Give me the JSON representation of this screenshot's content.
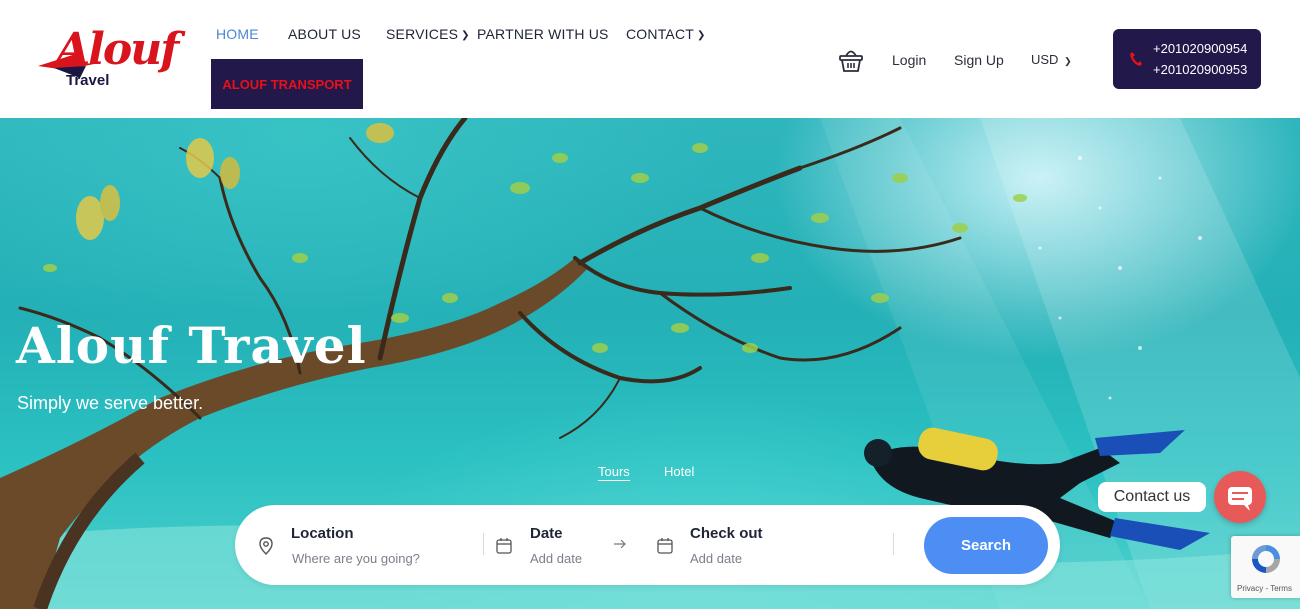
{
  "brand": {
    "logo_text": "Alouf",
    "logo_sub": "Travel"
  },
  "nav": {
    "items": [
      {
        "label": "HOME",
        "dropdown": false
      },
      {
        "label": "ABOUT US",
        "dropdown": false
      },
      {
        "label": "SERVICES",
        "dropdown": true
      },
      {
        "label": "PARTNER WITH US",
        "dropdown": false
      },
      {
        "label": "CONTACT",
        "dropdown": true
      }
    ],
    "transport_label": "ALOUF TRANSPORT"
  },
  "header": {
    "login": "Login",
    "signup": "Sign Up",
    "currency": "USD",
    "phones": [
      "+201020900954",
      "+201020900953"
    ]
  },
  "hero": {
    "title": "Alouf Travel",
    "subtitle": "Simply we serve better.",
    "tabs": [
      "Tours",
      "Hotel"
    ]
  },
  "search": {
    "location_label": "Location",
    "location_placeholder": "Where are you going?",
    "date_label": "Date",
    "date_placeholder": "Add date",
    "checkout_label": "Check out",
    "checkout_placeholder": "Add date",
    "button": "Search"
  },
  "widgets": {
    "contact_label": "Contact us",
    "recaptcha_text": "Privacy - Terms"
  },
  "colors": {
    "accent": "#4c8ef3",
    "brand_dark": "#22184a",
    "brand_red": "#d9141c",
    "active_nav": "#4b86d6"
  }
}
